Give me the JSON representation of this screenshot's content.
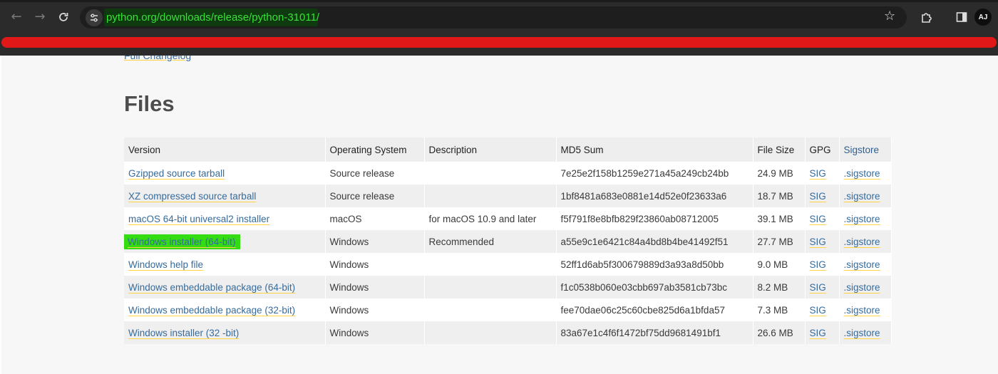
{
  "browser": {
    "url": "python.org/downloads/release/python-31011/",
    "profile_initials": "AJ"
  },
  "page": {
    "changelog_link": "Full Changelog",
    "files_heading": "Files"
  },
  "table": {
    "headers": [
      "Version",
      "Operating System",
      "Description",
      "MD5 Sum",
      "File Size",
      "GPG",
      "Sigstore"
    ],
    "rows": [
      {
        "version": "Gzipped source tarball",
        "os": "Source release",
        "description": "",
        "md5": "7e25e2f158b1259e271a45a249cb24bb",
        "size": "24.9 MB",
        "gpg": "SIG",
        "sigstore": ".sigstore"
      },
      {
        "version": "XZ compressed source tarball",
        "os": "Source release",
        "description": "",
        "md5": "1bf8481a683e0881e14d52e0f23633a6",
        "size": "18.7 MB",
        "gpg": "SIG",
        "sigstore": ".sigstore"
      },
      {
        "version": "macOS 64-bit universal2 installer",
        "os": "macOS",
        "description": "for macOS 10.9 and later",
        "md5": "f5f791f8e8bfb829f23860ab08712005",
        "size": "39.1 MB",
        "gpg": "SIG",
        "sigstore": ".sigstore"
      },
      {
        "version": "Windows installer (64-bit)",
        "os": "Windows",
        "description": "Recommended",
        "md5": "a55e9c1e6421c84a4bd8b4be41492f51",
        "size": "27.7 MB",
        "gpg": "SIG",
        "sigstore": ".sigstore"
      },
      {
        "version": "Windows help file",
        "os": "Windows",
        "description": "",
        "md5": "52ff1d6ab5f300679889d3a93a8d50bb",
        "size": "9.0 MB",
        "gpg": "SIG",
        "sigstore": ".sigstore"
      },
      {
        "version": "Windows embeddable package (64-bit)",
        "os": "Windows",
        "description": "",
        "md5": "f1c0538b060e03cbb697ab3581cb73bc",
        "size": "8.2 MB",
        "gpg": "SIG",
        "sigstore": ".sigstore"
      },
      {
        "version": "Windows embeddable package (32-bit)",
        "os": "Windows",
        "description": "",
        "md5": "fee70dae06c25c60cbe825d6a1bfda57",
        "size": "7.3 MB",
        "gpg": "SIG",
        "sigstore": ".sigstore"
      },
      {
        "version": "Windows installer (32 -bit)",
        "os": "Windows",
        "description": "",
        "md5": "83a67e1c4f6f1472bf75dd9681491bf1",
        "size": "26.6 MB",
        "gpg": "SIG",
        "sigstore": ".sigstore"
      }
    ]
  },
  "highlight": {
    "color": "#33dd11"
  },
  "colors": {
    "link": "#366b9c",
    "underline": "#ffd343",
    "redaction": "#e01818",
    "url_text": "#38e038"
  }
}
